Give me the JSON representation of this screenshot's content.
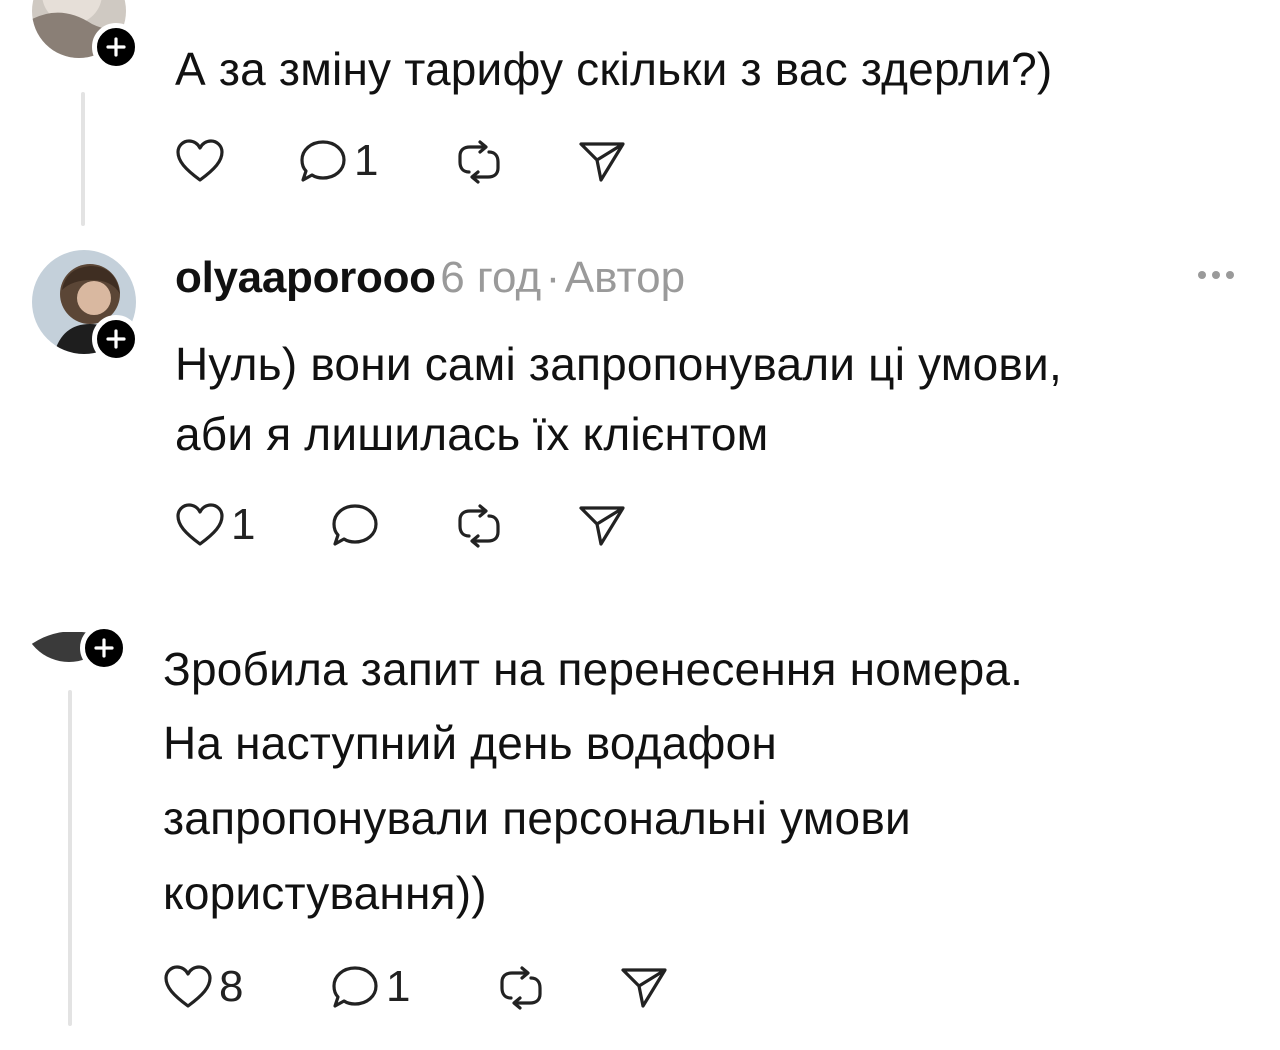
{
  "comments": [
    {
      "text": "А за зміну тарифу скільки з вас здерли?)",
      "actions": {
        "likes": "",
        "replies": "1"
      },
      "icons": {
        "follow": "plus-icon",
        "like": "heart-icon",
        "reply": "comment-icon",
        "repost": "repost-icon",
        "share": "send-icon"
      }
    },
    {
      "username": "olyaaporooo",
      "time": "6 год",
      "separator": "·",
      "role": "Автор",
      "lines": [
        "Нуль) вони самі запропонували ці умови,",
        "аби я лишилась їх клієнтом"
      ],
      "actions": {
        "likes": "1",
        "replies": ""
      },
      "icons": {
        "follow": "plus-icon",
        "like": "heart-icon",
        "reply": "comment-icon",
        "repost": "repost-icon",
        "share": "send-icon",
        "more": "more-icon"
      }
    },
    {
      "lines": [
        "Зробила запит на перенесення номера.",
        "На наступний день водафон",
        "запропонували персональні умови",
        "користування))"
      ],
      "actions": {
        "likes": "8",
        "replies": "1"
      },
      "icons": {
        "follow": "plus-icon",
        "like": "heart-icon",
        "reply": "comment-icon",
        "repost": "repost-icon",
        "share": "send-icon"
      }
    }
  ],
  "colors": {
    "text": "#111111",
    "muted": "#9a9a9a",
    "thread": "#e3e3e3"
  }
}
